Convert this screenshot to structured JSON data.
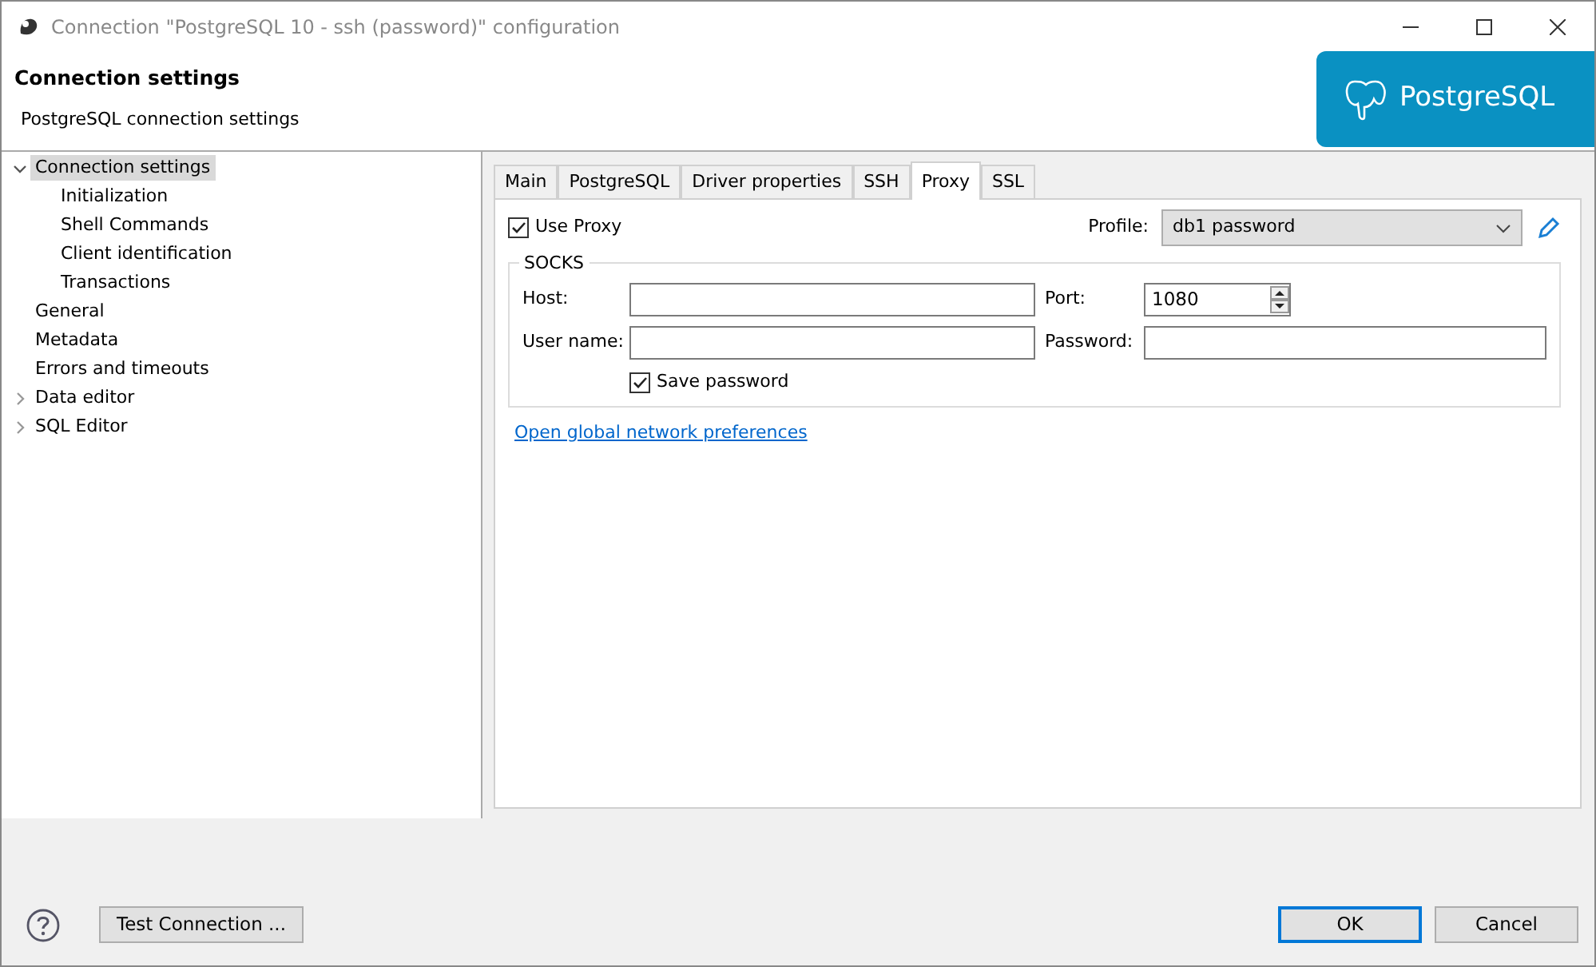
{
  "window": {
    "title": "Connection \"PostgreSQL 10 - ssh (password)\" configuration"
  },
  "header": {
    "title": "Connection settings",
    "subtitle": "PostgreSQL connection settings",
    "logo_text": "PostgreSQL"
  },
  "sidebar": {
    "items": [
      {
        "label": "Connection settings",
        "selected": true,
        "expanded": true,
        "children": [
          {
            "label": "Initialization",
            "selected": false
          },
          {
            "label": "Shell Commands",
            "selected": false
          },
          {
            "label": "Client identification",
            "selected": false
          },
          {
            "label": "Transactions",
            "selected": false
          }
        ]
      },
      {
        "label": "General",
        "selected": false
      },
      {
        "label": "Metadata",
        "selected": false
      },
      {
        "label": "Errors and timeouts",
        "selected": false
      },
      {
        "label": "Data editor",
        "selected": false,
        "expanded": false
      },
      {
        "label": "SQL Editor",
        "selected": false,
        "expanded": false
      }
    ]
  },
  "tabs": [
    {
      "label": "Main",
      "selected": false
    },
    {
      "label": "PostgreSQL",
      "selected": false
    },
    {
      "label": "Driver properties",
      "selected": false
    },
    {
      "label": "SSH",
      "selected": false
    },
    {
      "label": "Proxy",
      "selected": true
    },
    {
      "label": "SSL",
      "selected": false
    }
  ],
  "proxy": {
    "use_proxy": {
      "label": "Use Proxy",
      "checked": true
    },
    "profile": {
      "label": "Profile:",
      "value": "db1 password"
    },
    "socks": {
      "title": "SOCKS",
      "host": {
        "label": "Host:"
      },
      "port": {
        "label": "Port:",
        "value": "1080"
      },
      "user": {
        "label": "User name:"
      },
      "password": {
        "label": "Password:"
      },
      "save_password": {
        "label": "Save password",
        "checked": true
      }
    },
    "link": "Open global network preferences"
  },
  "footer": {
    "test_button": "Test Connection ...",
    "buttons": [
      {
        "label": "OK",
        "default": true
      },
      {
        "label": "Cancel",
        "default": false
      }
    ]
  }
}
